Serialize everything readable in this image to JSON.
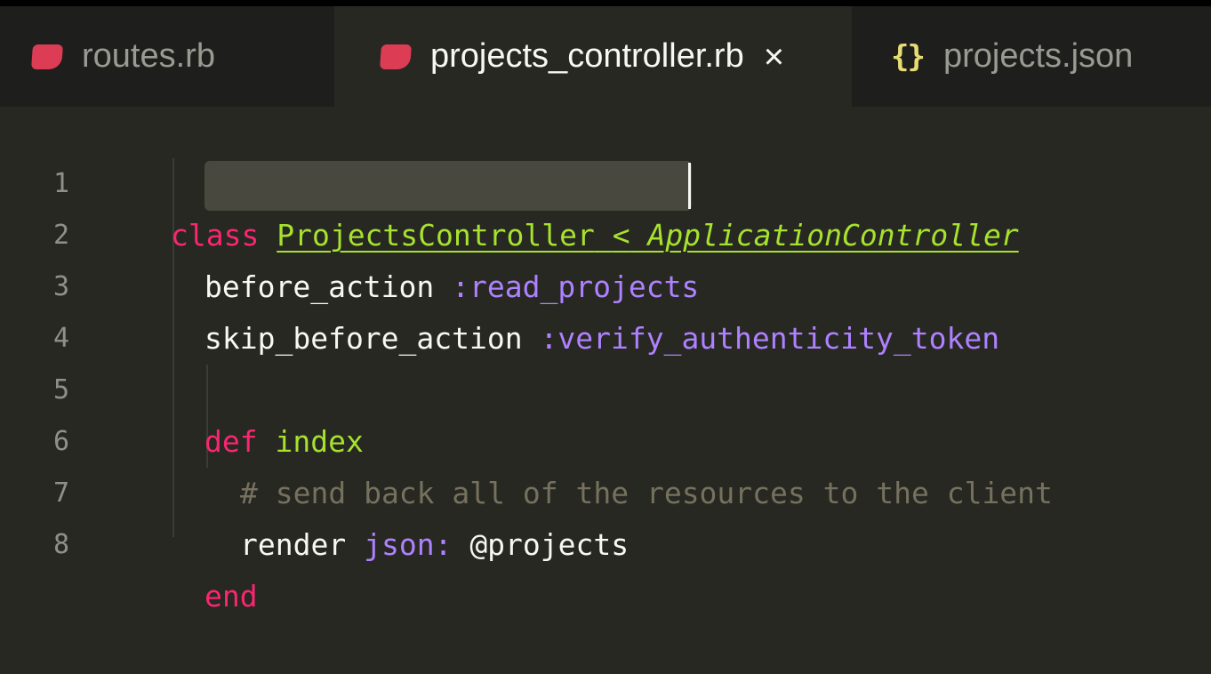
{
  "tabs": [
    {
      "label": "routes.rb",
      "icon": "ruby-icon",
      "active": false
    },
    {
      "label": "projects_controller.rb",
      "icon": "ruby-icon",
      "active": true,
      "close": "×"
    },
    {
      "label": "projects.json",
      "icon": "json-braces-icon",
      "icon_text": "{}",
      "active": false
    }
  ],
  "editor": {
    "line_numbers": [
      "1",
      "2",
      "3",
      "4",
      "5",
      "6",
      "7",
      "8"
    ],
    "lines": {
      "l1": {
        "kw": "class",
        "cls": "ProjectsController",
        "op": "<",
        "sup": "ApplicationController"
      },
      "l2": {
        "call": "before_action",
        "sym": ":read_projects"
      },
      "l3": {
        "call": "skip_before_action",
        "sym": ":verify_authenticity_token"
      },
      "l5": {
        "kw": "def",
        "name": "index"
      },
      "l6": {
        "comment": "# send back all of the resources to the client"
      },
      "l7": {
        "call": "render",
        "key": "json:",
        "ivar": "@projects"
      },
      "l8": {
        "kw": "end"
      }
    }
  },
  "colors": {
    "background": "#272822",
    "keyword": "#f92672",
    "class_name": "#a6e22e",
    "symbol": "#ae81ff",
    "comment": "#75715e",
    "ruby_icon": "#dc3d55",
    "json_icon": "#e6db74"
  }
}
